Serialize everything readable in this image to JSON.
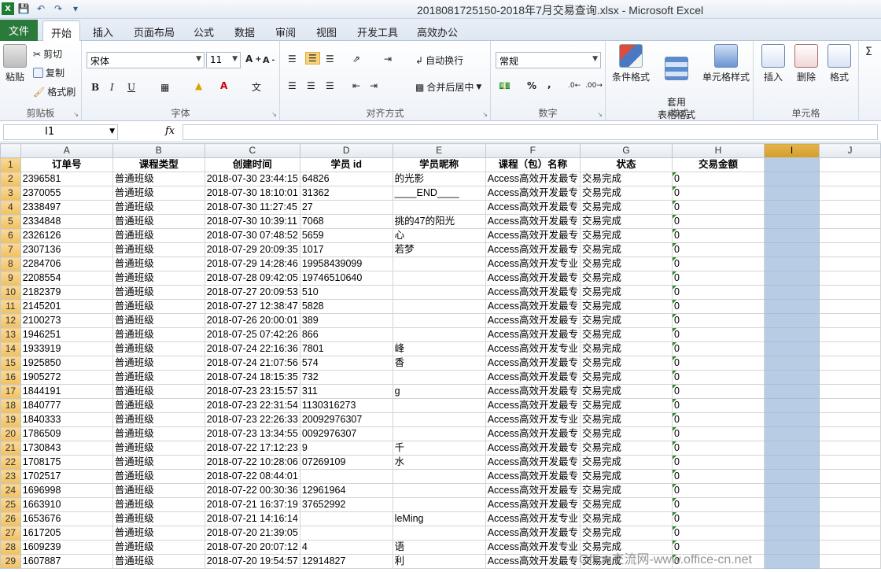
{
  "window": {
    "title": "2018081725150-2018年7月交易查询.xlsx - Microsoft Excel"
  },
  "tabs": [
    "文件",
    "开始",
    "插入",
    "页面布局",
    "公式",
    "数据",
    "审阅",
    "视图",
    "开发工具",
    "高效办公"
  ],
  "ribbon": {
    "clipboard": {
      "label": "剪贴板",
      "paste": "粘贴",
      "cut": "剪切",
      "copy": "复制",
      "format_painter": "格式刷"
    },
    "font": {
      "label": "字体",
      "name": "宋体",
      "size": "11",
      "bold": "B",
      "italic": "I",
      "underline": "U"
    },
    "alignment": {
      "label": "对齐方式",
      "wrap": "自动换行",
      "merge": "合并后居中"
    },
    "number": {
      "label": "数字",
      "format": "常规",
      "percent": "%",
      "comma": ","
    },
    "styles": {
      "label": "样式",
      "conditional": "条件格式",
      "table": "套用\n表格格式",
      "cell_styles": "单元格样式"
    },
    "cells": {
      "label": "单元格",
      "insert": "插入",
      "delete": "删除",
      "format": "格式"
    }
  },
  "formula_bar": {
    "name_box": "I1",
    "fx": "fx",
    "value": ""
  },
  "columns": [
    "A",
    "B",
    "C",
    "D",
    "E",
    "F",
    "G",
    "H",
    "I",
    "J"
  ],
  "headers": [
    "订单号",
    "课程类型",
    "创建时间",
    "学员 id",
    "学员昵称",
    "课程（包）名称",
    "状态",
    "交易金额",
    "",
    ""
  ],
  "rows": [
    [
      "2396581",
      "普通班级",
      "2018-07-30 23:44:15",
      "64826",
      "的光影",
      "Access高效开发最专",
      "交易完成",
      "0"
    ],
    [
      "2370055",
      "普通班级",
      "2018-07-30 18:10:01",
      "31362",
      "____END____",
      "Access高效开发最专",
      "交易完成",
      "0"
    ],
    [
      "2338497",
      "普通班级",
      "2018-07-30 11:27:45",
      "27",
      "",
      "Access高效开发最专",
      "交易完成",
      "0"
    ],
    [
      "2334848",
      "普通班级",
      "2018-07-30 10:39:11",
      "7068",
      "挑的47的阳光",
      "Access高效开发最专",
      "交易完成",
      "0"
    ],
    [
      "2326126",
      "普通班级",
      "2018-07-30 07:48:52",
      "5659",
      "心",
      "Access高效开发最专",
      "交易完成",
      "0"
    ],
    [
      "2307136",
      "普通班级",
      "2018-07-29 20:09:35",
      "1017",
      "若梦",
      "Access高效开发最专",
      "交易完成",
      "0"
    ],
    [
      "2284706",
      "普通班级",
      "2018-07-29 14:28:46",
      "19958439099",
      "",
      "Access高效开发专业",
      "交易完成",
      "0"
    ],
    [
      "2208554",
      "普通班级",
      "2018-07-28 09:42:05",
      "19746510640",
      "",
      "Access高效开发最专",
      "交易完成",
      "0"
    ],
    [
      "2182379",
      "普通班级",
      "2018-07-27 20:09:53",
      "510",
      "",
      "Access高效开发最专",
      "交易完成",
      "0"
    ],
    [
      "2145201",
      "普通班级",
      "2018-07-27 12:38:47",
      "5828",
      "",
      "Access高效开发最专",
      "交易完成",
      "0"
    ],
    [
      "2100273",
      "普通班级",
      "2018-07-26 20:00:01",
      "389",
      "",
      "Access高效开发最专",
      "交易完成",
      "0"
    ],
    [
      "1946251",
      "普通班级",
      "2018-07-25 07:42:26",
      "866",
      "",
      "Access高效开发最专",
      "交易完成",
      "0"
    ],
    [
      "1933919",
      "普通班级",
      "2018-07-24 22:16:36",
      "7801",
      "峰",
      "Access高效开发专业",
      "交易完成",
      "0"
    ],
    [
      "1925850",
      "普通班级",
      "2018-07-24 21:07:56",
      "574",
      "香",
      "Access高效开发最专",
      "交易完成",
      "0"
    ],
    [
      "1905272",
      "普通班级",
      "2018-07-24 18:15:35",
      "732",
      "",
      "Access高效开发最专",
      "交易完成",
      "0"
    ],
    [
      "1844191",
      "普通班级",
      "2018-07-23 23:15:57",
      "311",
      "g",
      "Access高效开发最专",
      "交易完成",
      "0"
    ],
    [
      "1840777",
      "普通班级",
      "2018-07-23 22:31:54",
      "1130316273",
      "",
      "Access高效开发最专",
      "交易完成",
      "0"
    ],
    [
      "1840333",
      "普通班级",
      "2018-07-23 22:26:33",
      "20092976307",
      "",
      "Access高效开发专业",
      "交易完成",
      "0"
    ],
    [
      "1786509",
      "普通班级",
      "2018-07-23 13:34:55",
      "0092976307",
      "",
      "Access高效开发最专",
      "交易完成",
      "0"
    ],
    [
      "1730843",
      "普通班级",
      "2018-07-22 17:12:23",
      "9",
      "千",
      "Access高效开发最专",
      "交易完成",
      "0"
    ],
    [
      "1708175",
      "普通班级",
      "2018-07-22 10:28:06",
      "07269109",
      "水",
      "Access高效开发最专",
      "交易完成",
      "0"
    ],
    [
      "1702517",
      "普通班级",
      "2018-07-22 08:44:01",
      "",
      "",
      "Access高效开发最专",
      "交易完成",
      "0"
    ],
    [
      "1696998",
      "普通班级",
      "2018-07-22 00:30:36",
      "12961964",
      "",
      "Access高效开发最专",
      "交易完成",
      "0"
    ],
    [
      "1663910",
      "普通班级",
      "2018-07-21 16:37:19",
      "37652992",
      "",
      "Access高效开发最专",
      "交易完成",
      "0"
    ],
    [
      "1653676",
      "普通班级",
      "2018-07-21 14:16:14",
      "",
      "leMing",
      "Access高效开发专业",
      "交易完成",
      "0"
    ],
    [
      "1617205",
      "普通班级",
      "2018-07-20 21:39:05",
      "",
      "",
      "Access高效开发最专",
      "交易完成",
      "0"
    ],
    [
      "1609239",
      "普通班级",
      "2018-07-20 20:07:12",
      "4",
      "语",
      "Access高效开发专业",
      "交易完成",
      "0"
    ],
    [
      "1607887",
      "普通班级",
      "2018-07-20 19:54:57",
      "12914827",
      "利",
      "Access高效开发最专",
      "交易完成",
      "0"
    ]
  ],
  "watermark": "Office交流网-www.office-cn.net",
  "colors": {
    "file_tab": "#2a7a3c",
    "selected_column": "#b8cce4"
  }
}
